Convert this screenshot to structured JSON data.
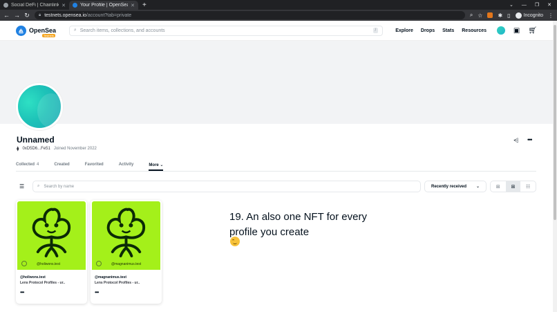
{
  "browser": {
    "tabs": [
      {
        "title": "Social DeFi | Chainlink Ha"
      },
      {
        "title": "Your Profile | OpenSea"
      }
    ],
    "url_host": "testnets.opensea.io",
    "url_path": "/account?tab=private",
    "profile_label": "Incognito"
  },
  "header": {
    "logo_text": "OpenSea",
    "badge": "Testnets",
    "search_placeholder": "Search items, collections, and accounts",
    "search_shortcut": "/",
    "nav": [
      "Explore",
      "Drops",
      "Stats",
      "Resources"
    ]
  },
  "profile": {
    "name": "Unnamed",
    "address": "0xD5D6...Fe51",
    "joined": "Joined November 2022",
    "tabs": [
      {
        "label": "Collected",
        "count": "4"
      },
      {
        "label": "Created"
      },
      {
        "label": "Favorited"
      },
      {
        "label": "Activity"
      },
      {
        "label": "More"
      }
    ]
  },
  "filters": {
    "search_placeholder": "Search by name",
    "sort_label": "Recently received"
  },
  "cards": [
    {
      "handle": "@holiwons.test",
      "collection": "Lens Protocol Profiles - ur..",
      "image_label": "@holiwons.test"
    },
    {
      "handle": "@magnanimus.test",
      "collection": "Lens Protocol Profiles - ur..",
      "image_label": "@magnanimus.test"
    }
  ],
  "caption": "19. An also one NFT for every profile you create",
  "colors": {
    "accent": "#2081e2",
    "nft_bg": "#a4f01a",
    "avatar": "#1ec3b8"
  }
}
